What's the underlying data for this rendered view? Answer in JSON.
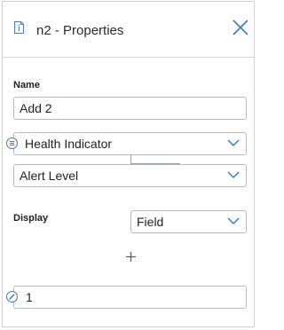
{
  "header": {
    "title": "n2 - Properties",
    "icon": "info-document-icon",
    "close_icon": "close-icon"
  },
  "name_section": {
    "label": "Name",
    "value": "Add 2"
  },
  "source": {
    "first_select": "Health Indicator",
    "second_select": "Alert Level",
    "link_icon": "list-circle-icon"
  },
  "display": {
    "label": "Display",
    "value": "Field"
  },
  "add_icon": "plus-icon",
  "edit_field": {
    "icon": "pencil-circle-icon",
    "value": "1"
  },
  "colors": {
    "accent": "#3a7bbf",
    "border": "#b3b9bd"
  }
}
